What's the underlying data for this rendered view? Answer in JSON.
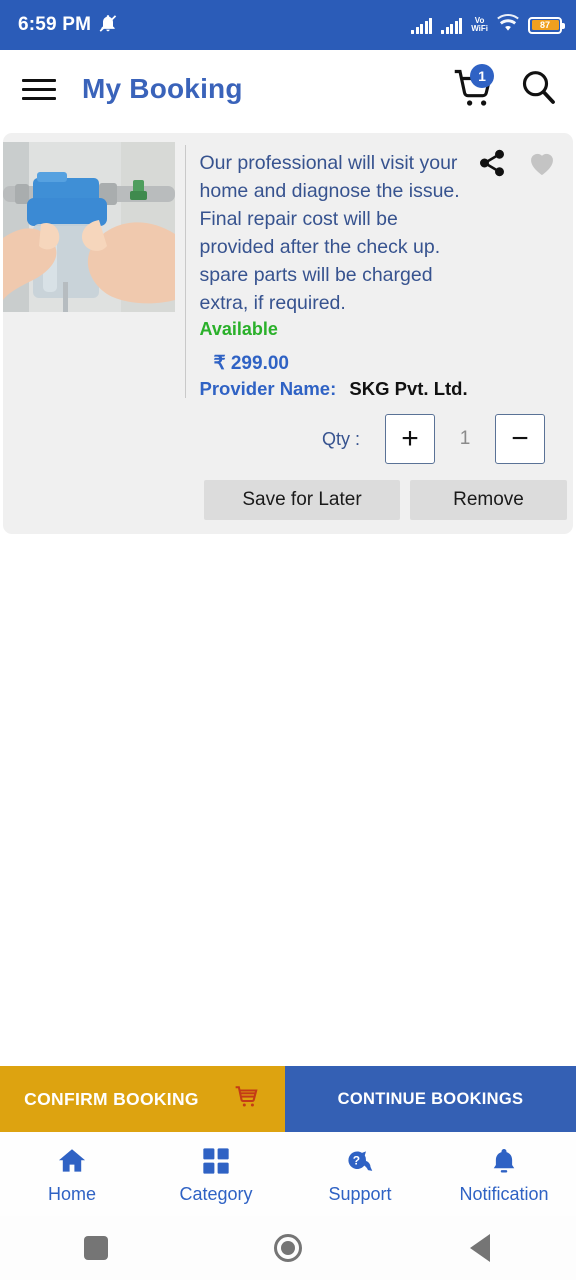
{
  "status_bar": {
    "time": "6:59 PM",
    "mute_icon": "bell-muted-icon",
    "network_label": "Vo\nWiFi",
    "vo_line1": "Vo",
    "vo_line2": "WiFi",
    "battery_percent": "87"
  },
  "app_bar": {
    "menu_icon": "hamburger-menu-icon",
    "title": "My Booking",
    "cart_icon": "cart-icon",
    "cart_badge": "1",
    "search_icon": "search-icon"
  },
  "booking_card": {
    "image_alt": "water-filter-installation-photo",
    "description": "Our professional will visit your home and diagnose the issue. Final repair cost will be provided after the check up. spare parts will be charged extra, if required.",
    "availability": "Available",
    "price": "₹ 299.00",
    "provider_label": "Provider Name:",
    "provider_value": "SKG Pvt. Ltd.",
    "share_icon": "share-icon",
    "favorite_icon": "heart-icon",
    "qty_label": "Qty :",
    "qty_increase": "+",
    "qty_value": "1",
    "qty_decrease": "−",
    "save_label": "Save for Later",
    "remove_label": "Remove"
  },
  "bottom_actions": {
    "confirm_label": "CONFIRM BOOKING",
    "confirm_icon": "cart-icon",
    "continue_label": "CONTINUE BOOKINGS"
  },
  "bottom_nav": {
    "items": [
      {
        "label": "Home",
        "icon": "home-icon"
      },
      {
        "label": "Category",
        "icon": "grid-icon"
      },
      {
        "label": "Support",
        "icon": "chat-question-icon"
      },
      {
        "label": "Notification",
        "icon": "bell-icon"
      }
    ]
  },
  "system_nav": {
    "recents": "recents-square-icon",
    "home": "home-circle-icon",
    "back": "back-triangle-icon"
  },
  "colors": {
    "status_bar": "#2b5cb8",
    "brand_blue": "#2f62c4",
    "title_blue": "#3a63ba",
    "available_green": "#2ab02a",
    "confirm_amber": "#dda310",
    "continue_blue": "#3460b4",
    "card_bg": "#f0f0f0",
    "battery_fill": "#f0a020"
  }
}
